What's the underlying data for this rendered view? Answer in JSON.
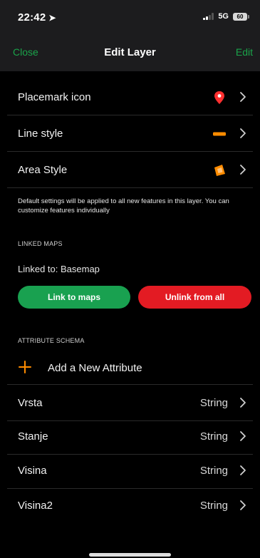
{
  "status_bar": {
    "time": "22:42",
    "network": "5G",
    "battery": "60"
  },
  "nav": {
    "close_label": "Close",
    "title": "Edit Layer",
    "edit_label": "Edit"
  },
  "style_rows": [
    {
      "label": "Placemark icon",
      "icon": "map-pin-icon"
    },
    {
      "label": "Line style",
      "icon": "line-swatch-icon"
    },
    {
      "label": "Area Style",
      "icon": "area-swatch-icon"
    }
  ],
  "note": "Default settings will be applied to all new features in this layer. You can customize features individually",
  "linked_maps": {
    "header": "LINKED MAPS",
    "linked_to": "Linked to: Basemap",
    "link_button": "Link to maps",
    "unlink_button": "Unlink from all"
  },
  "attribute_schema": {
    "header": "ATTRIBUTE SCHEMA",
    "add_label": "Add a New Attribute",
    "attributes": [
      {
        "name": "Vrsta",
        "type": "String"
      },
      {
        "name": "Stanje",
        "type": "String"
      },
      {
        "name": "Visina",
        "type": "String"
      },
      {
        "name": "Visina2",
        "type": "String"
      }
    ]
  },
  "colors": {
    "accent_green": "#19a150",
    "danger_red": "#e31b23",
    "style_orange": "#ff8c00",
    "pin_red": "#ff3030"
  }
}
